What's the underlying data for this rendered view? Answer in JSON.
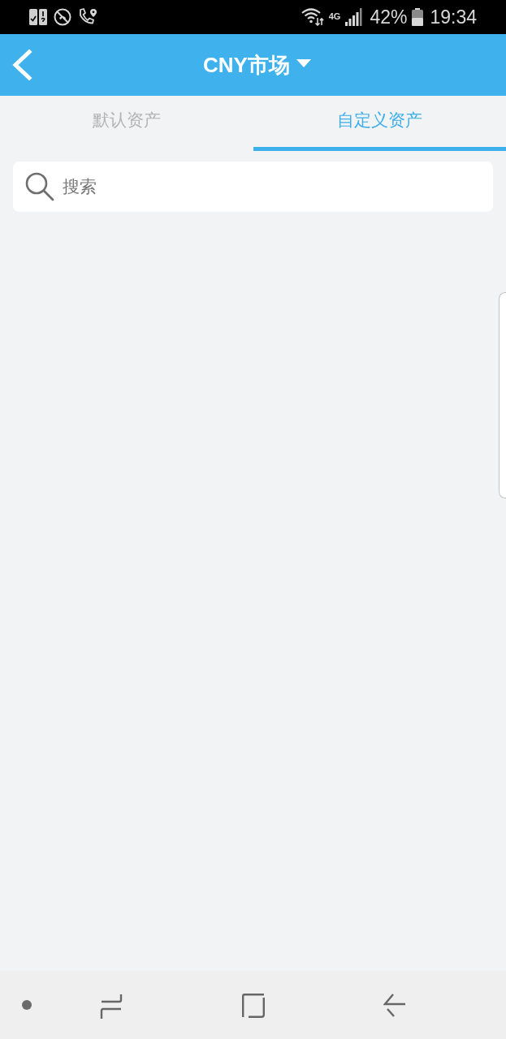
{
  "status_bar": {
    "network": "4G",
    "battery": "42%",
    "time": "19:34"
  },
  "header": {
    "title": "CNY市场"
  },
  "tabs": [
    {
      "label": "默认资产",
      "selected": false
    },
    {
      "label": "自定义资产",
      "selected": true
    }
  ],
  "search": {
    "placeholder": "搜索"
  }
}
